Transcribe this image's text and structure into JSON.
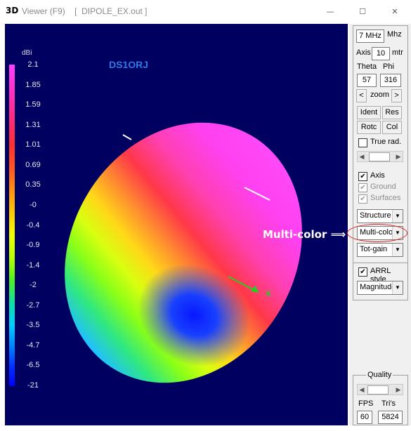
{
  "window": {
    "app_icon_text": "3D",
    "title": "Viewer (F9)    [  DIPOLE_EX.out ]",
    "minimize_glyph": "—",
    "maximize_glyph": "☐",
    "close_glyph": "✕"
  },
  "viewport": {
    "colorbar_unit": "dBi",
    "colorbar_ticks": [
      "2.1",
      "1.85",
      "1.59",
      "1.31",
      "1.01",
      "0.69",
      "0.35",
      "-0",
      "-0.4",
      "-0.9",
      "-1.4",
      "-2",
      "-2.7",
      "-3.5",
      "-4.7",
      "-6.5",
      "-21"
    ],
    "callsign": "DS1ORJ",
    "axis_marker": "x"
  },
  "panel": {
    "frequency": "7 MHz",
    "freq_unit": "Mhz",
    "axis_label": "Axis",
    "axis_value": "10",
    "axis_unit": "mtr",
    "theta_label": "Theta",
    "phi_label": "Phi",
    "theta_value": "57",
    "phi_value": "316",
    "zoom_left": "<",
    "zoom_label": "zoom",
    "zoom_right": ">",
    "buttons": [
      "Ident",
      "Res",
      "Rotc",
      "Col"
    ],
    "true_rad_label": "True rad.",
    "checks": [
      {
        "label": "Axis",
        "checked": true,
        "enabled": true
      },
      {
        "label": "Ground",
        "checked": true,
        "enabled": false
      },
      {
        "label": "Surfaces",
        "checked": true,
        "enabled": false
      }
    ],
    "combo_structure": "Structure",
    "combo_color": "Multi-color",
    "combo_gain": "Tot-gain",
    "arrl_label": "ARRL style",
    "combo_magnitude": "Magnitude",
    "quality_label": "Quality",
    "fps_label": "FPS",
    "tris_label": "Tri's",
    "fps_value": "60",
    "tris_value": "5824"
  },
  "annotation": {
    "label": "Multi-color",
    "arrow": "⟹"
  },
  "colors": {
    "viewport_bg": "#000060",
    "callsign": "#2f79e6",
    "annotation_circle": "#e02020"
  }
}
